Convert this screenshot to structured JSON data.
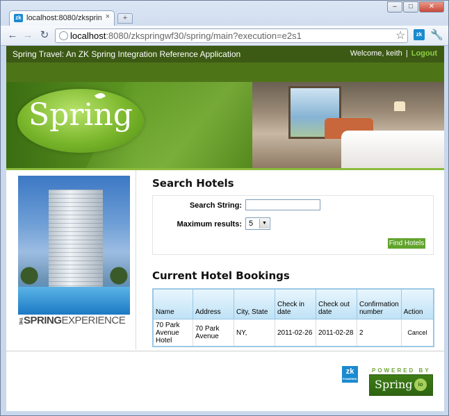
{
  "browser": {
    "tab_title": "localhost:8080/zkspringw...",
    "tab_close": "×",
    "tab_favicon": "zk",
    "new_tab": "+",
    "window_controls": {
      "minimize": "–",
      "maximize": "□",
      "close": "✕"
    },
    "url_host": "localhost",
    "url_rest": ":8080/zkspringwf30/spring/main?execution=e2s1",
    "ext_icon": "zk",
    "icons": [
      "back-icon",
      "forward-icon",
      "reload-icon",
      "globe-icon",
      "star-icon",
      "wrench-icon"
    ]
  },
  "header": {
    "app_title": "Spring Travel: An ZK Spring Integration Reference Application",
    "welcome": "Welcome, keith",
    "separator": "|",
    "logout_label": "Logout"
  },
  "banner": {
    "logo_text": "Spring"
  },
  "sidebar": {
    "the_label": "THE",
    "spring_label": "SPRING",
    "experience_label": "EXPERIENCE"
  },
  "search": {
    "title": "Search Hotels",
    "search_label": "Search String:",
    "search_value": "",
    "max_label": "Maximum results:",
    "max_value": "5",
    "find_button": "Find Hotels"
  },
  "bookings": {
    "title": "Current Hotel Bookings",
    "columns": [
      "Name",
      "Address",
      "City, State",
      "Check in date",
      "Check out date",
      "Confirmation number",
      "Action"
    ],
    "rows": [
      {
        "name": "70 Park Avenue Hotel",
        "address": "70 Park Avenue",
        "city_state": "NY,",
        "check_in": "2011-02-26",
        "check_out": "2011-02-28",
        "confirmation": "2",
        "action": "Cancel"
      }
    ]
  },
  "footer": {
    "zk_logo": "zk",
    "zk_powered": "POWERED",
    "powered_by": "POWERED BY",
    "spring_logo": "Spring",
    "io_logo": "io"
  },
  "colors": {
    "header_bg": "#3c5a14",
    "logout_link": "#8ed042",
    "find_button": "#61a42c",
    "table_header": "#bfe2f6"
  }
}
